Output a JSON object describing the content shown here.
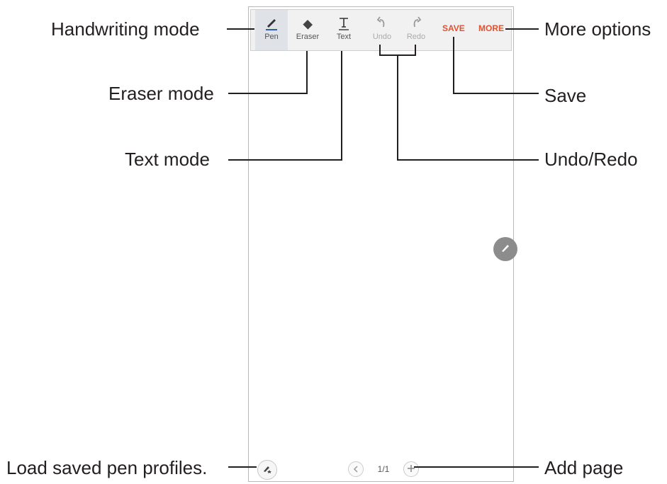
{
  "toolbar": {
    "pen_label": "Pen",
    "eraser_label": "Eraser",
    "text_label": "Text",
    "undo_label": "Undo",
    "redo_label": "Redo",
    "save_label": "SAVE",
    "more_label": "MORE",
    "accent_color": "#e0532e"
  },
  "pager": {
    "page_indicator": "1/1"
  },
  "callouts": {
    "handwriting_mode": "Handwriting mode",
    "eraser_mode": "Eraser mode",
    "text_mode": "Text mode",
    "load_pen_profiles": "Load saved pen profiles.",
    "more_options": "More options",
    "save": "Save",
    "undo_redo": "Undo/Redo",
    "add_page": "Add page"
  },
  "icons": [
    "pen-icon",
    "eraser-icon",
    "text-icon",
    "undo-icon",
    "redo-icon",
    "pencil-icon",
    "pen-profile-icon",
    "chevron-left-icon",
    "plus-icon"
  ]
}
